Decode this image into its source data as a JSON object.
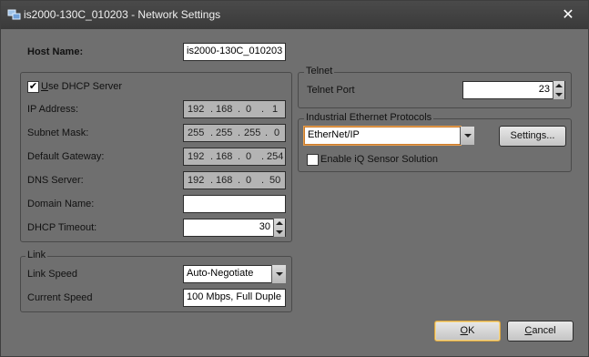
{
  "window": {
    "title": "is2000-130C_010203 - Network Settings",
    "close_glyph": "✕",
    "icon": "network-app-icon"
  },
  "host": {
    "label": "Host Name:",
    "value": "is2000-130C_010203"
  },
  "dhcp": {
    "use_dhcp_label_u": "U",
    "use_dhcp_label_rest": "se DHCP Server",
    "use_dhcp_checked": true,
    "check_glyph": "✔",
    "ip_label": "IP Address:",
    "ip": [
      "192",
      "168",
      "0",
      "1"
    ],
    "mask_label": "Subnet Mask:",
    "mask": [
      "255",
      "255",
      "255",
      "0"
    ],
    "gateway_label": "Default Gateway:",
    "gateway": [
      "192",
      "168",
      "0",
      "254"
    ],
    "dns_label": "DNS Server:",
    "dns": [
      "192",
      "168",
      "0",
      "50"
    ],
    "domain_label": "Domain Name:",
    "domain_value": "",
    "timeout_label": "DHCP Timeout:",
    "timeout_value": "30",
    "dot": "."
  },
  "link": {
    "group_title": "Link",
    "speed_label": "Link Speed",
    "speed_value": "Auto-Negotiate",
    "current_label": "Current Speed",
    "current_value": "100 Mbps, Full Duple"
  },
  "telnet": {
    "group_title": "Telnet",
    "port_label": "Telnet Port",
    "port_value": "23"
  },
  "industrial": {
    "group_title": "Industrial Ethernet Protocols",
    "protocol_value": "EtherNet/IP",
    "settings_label": "Settings...",
    "iq_label": "Enable iQ Sensor Solution",
    "iq_checked": false
  },
  "footer": {
    "ok_u": "O",
    "ok_rest": "K",
    "cancel_u": "C",
    "cancel_rest": "ancel"
  }
}
